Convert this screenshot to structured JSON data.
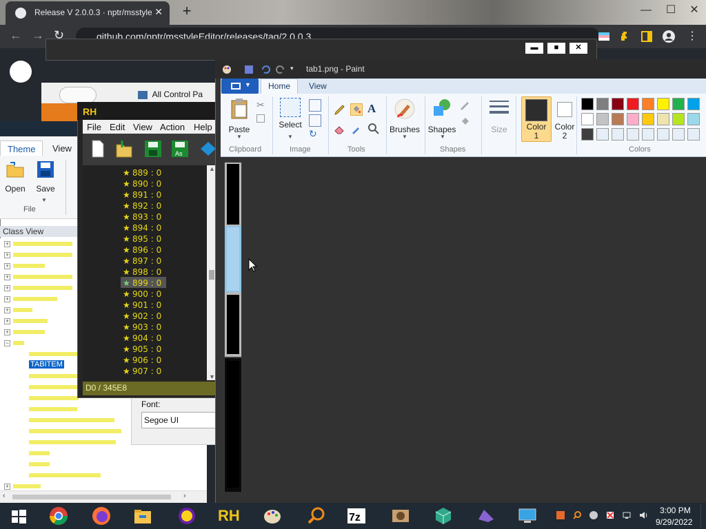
{
  "browser": {
    "tab_title": "Release V 2.0.0.3 · nptr/msstyleEditor",
    "tab_close": "✕",
    "new_tab": "+",
    "url": "github.com/nptr/msstyleEditor/releases/tag/2.0.0.3",
    "window_min": "—",
    "window_max": "☐",
    "window_close": "✕"
  },
  "control_panel": {
    "breadcrumb": "All Control Pa"
  },
  "background_window_buttons": {
    "min": "▬",
    "max": "■",
    "close": "✕"
  },
  "msstyle_editor": {
    "tabs": [
      "Theme",
      "View"
    ],
    "ribbon": {
      "open_label": "Open",
      "save_label": "Save",
      "group_label": "File"
    },
    "classview_title": "Class View",
    "tree_selected": "TABITEM"
  },
  "font_panel": {
    "label": "Font:",
    "value": "Segoe UI"
  },
  "resource_hacker": {
    "logo": "RH",
    "menu": [
      "File",
      "Edit",
      "View",
      "Action",
      "Help"
    ],
    "list": [
      "889 : 0",
      "890 : 0",
      "891 : 0",
      "892 : 0",
      "893 : 0",
      "894 : 0",
      "895 : 0",
      "896 : 0",
      "897 : 0",
      "898 : 0",
      "899 : 0",
      "900 : 0",
      "901 : 0",
      "902 : 0",
      "903 : 0",
      "904 : 0",
      "905 : 0",
      "906 : 0",
      "907 : 0"
    ],
    "selected_item": "899 : 0",
    "status": "D0 / 345E8"
  },
  "paint": {
    "title": "tab1.png - Paint",
    "tabs": {
      "home": "Home",
      "view": "View"
    },
    "clipboard": {
      "paste": "Paste",
      "label": "Clipboard"
    },
    "image": {
      "select": "Select",
      "label": "Image"
    },
    "tools": {
      "label": "Tools"
    },
    "brushes": "Brushes",
    "shapes": {
      "button": "Shapes",
      "label": "Shapes"
    },
    "size": "Size",
    "color1": {
      "line1": "Color",
      "line2": "1"
    },
    "color2": {
      "line1": "Color",
      "line2": "2"
    },
    "colors_label": "Colors",
    "palette_row1": [
      "#000000",
      "#7f7f7f",
      "#880015",
      "#ed1c24",
      "#ff7f27",
      "#fff200",
      "#22b14c",
      "#00a2e8"
    ],
    "palette_row2": [
      "#ffffff",
      "#c3c3c3",
      "#b97a57",
      "#ffaec9",
      "#ffc90e",
      "#efe4b0",
      "#b5e61d",
      "#99d9ea"
    ],
    "palette_row3": [
      "#3f3f3f",
      "#e6eef7",
      "#e6eef7",
      "#e6eef7",
      "#e6eef7",
      "#e6eef7",
      "#e6eef7",
      "#e6eef7"
    ]
  },
  "taskbar": {
    "time": "3:00 PM",
    "date": "9/29/2022",
    "apps": [
      "start",
      "chrome",
      "firefox",
      "file-explorer",
      "yahoo-messenger",
      "resource-hacker",
      "paint",
      "search-tool",
      "7zip",
      "gimp",
      "cube-tool",
      "visual-studio",
      "remote-desktop"
    ]
  }
}
